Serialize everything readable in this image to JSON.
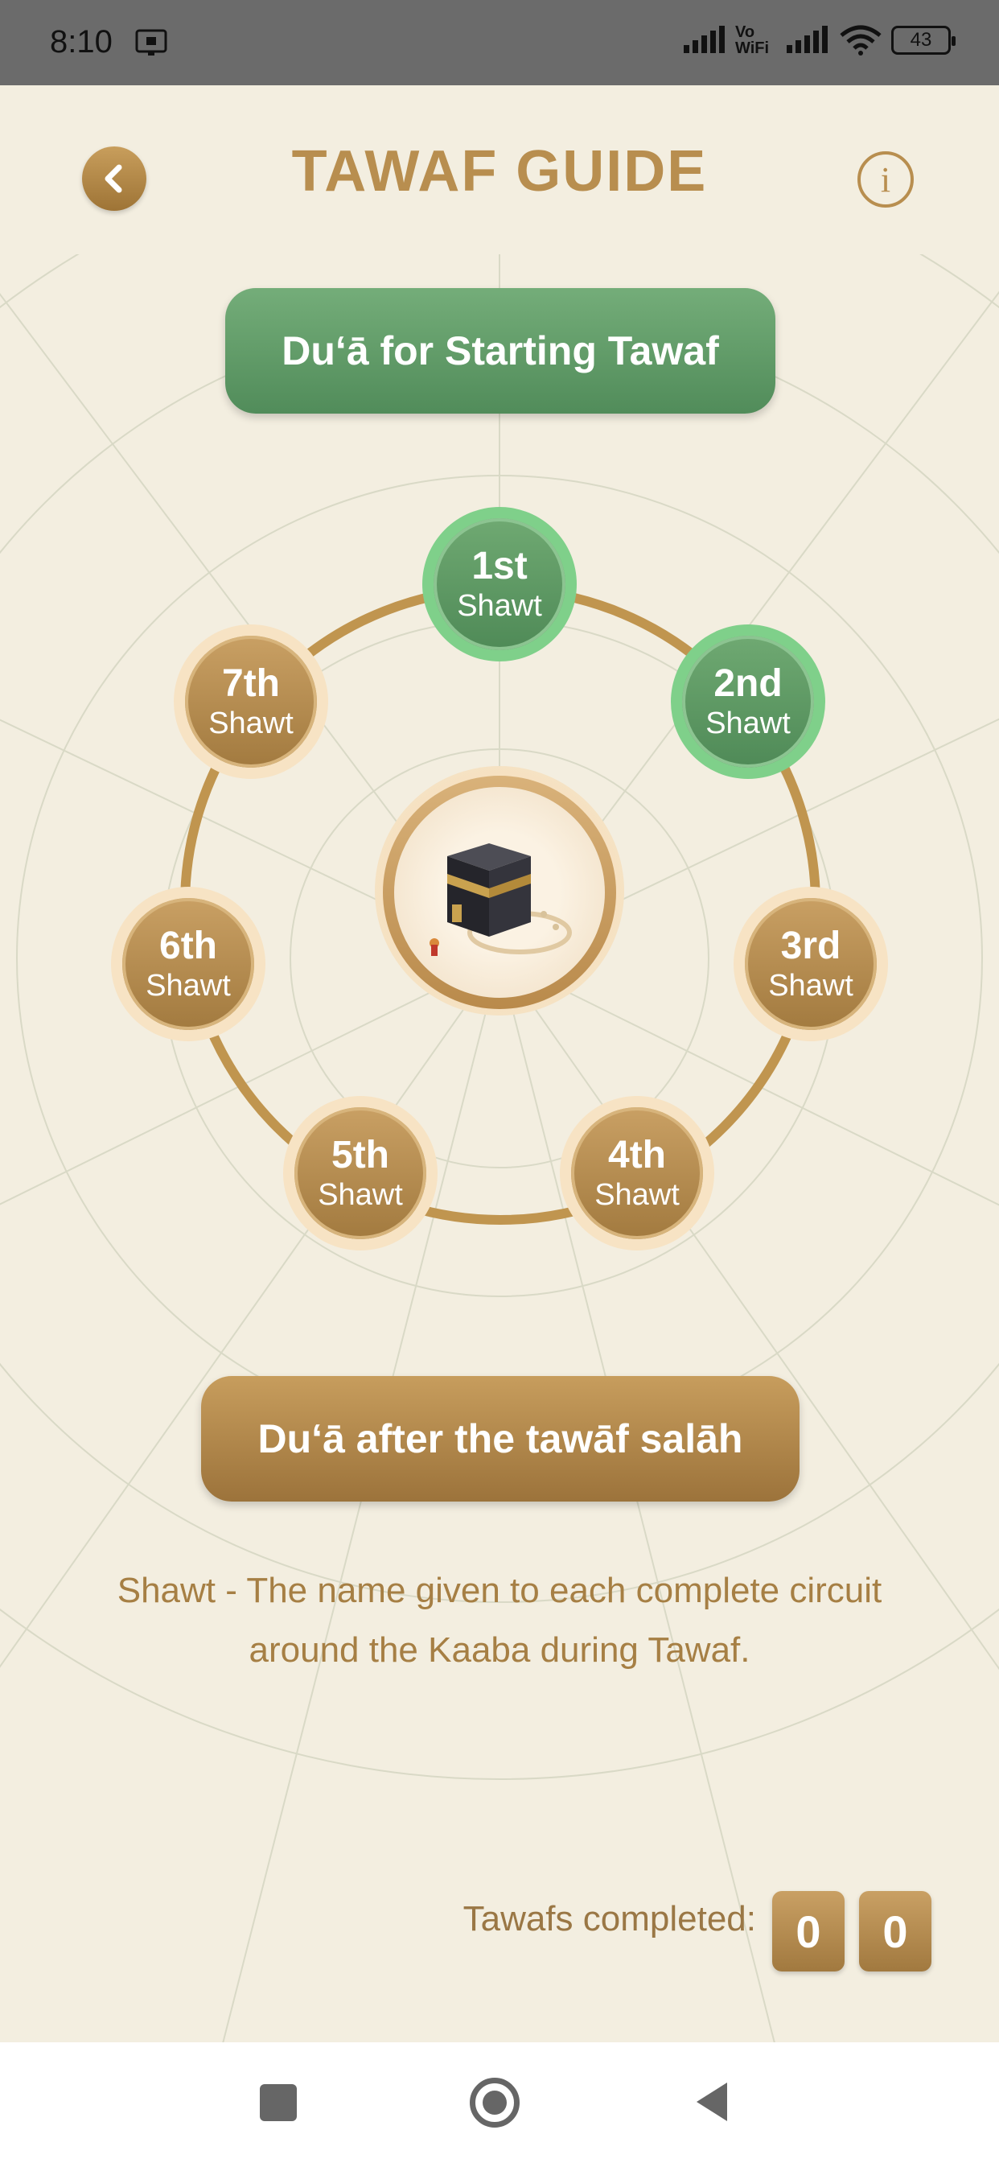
{
  "status_bar": {
    "time": "8:10",
    "network_label": "Vo WiFi",
    "battery": "43",
    "icons": [
      "cast-icon",
      "signal-icon",
      "vowifi-icon",
      "signal-icon",
      "wifi-icon",
      "battery-icon"
    ]
  },
  "header": {
    "title": "TAWAF GUIDE",
    "back_icon": "chevron-left-icon",
    "info_icon": "info-icon",
    "info_glyph": "i"
  },
  "dua_start_button": "Du‘ā for Starting Tawaf",
  "dua_after_button": "Du‘ā after the tawāf salāh",
  "circuits": [
    {
      "num": "1st",
      "label": "Shawt",
      "state": "completed"
    },
    {
      "num": "2nd",
      "label": "Shawt",
      "state": "completed"
    },
    {
      "num": "3rd",
      "label": "Shawt",
      "state": "pending"
    },
    {
      "num": "4th",
      "label": "Shawt",
      "state": "pending"
    },
    {
      "num": "5th",
      "label": "Shawt",
      "state": "pending"
    },
    {
      "num": "6th",
      "label": "Shawt",
      "state": "pending"
    },
    {
      "num": "7th",
      "label": "Shawt",
      "state": "pending"
    }
  ],
  "caption": "Shawt - The name given to each complete circuit around the Kaaba during Tawaf.",
  "counter": {
    "label": "Tawafs completed:",
    "digits": [
      "0",
      "0"
    ]
  },
  "colors": {
    "gold": "#b88e4f",
    "green": "#5e9a65",
    "background": "#f3eee0"
  },
  "nav_bar": {
    "icons": [
      "recents-square-icon",
      "home-circle-icon",
      "back-triangle-icon"
    ]
  }
}
